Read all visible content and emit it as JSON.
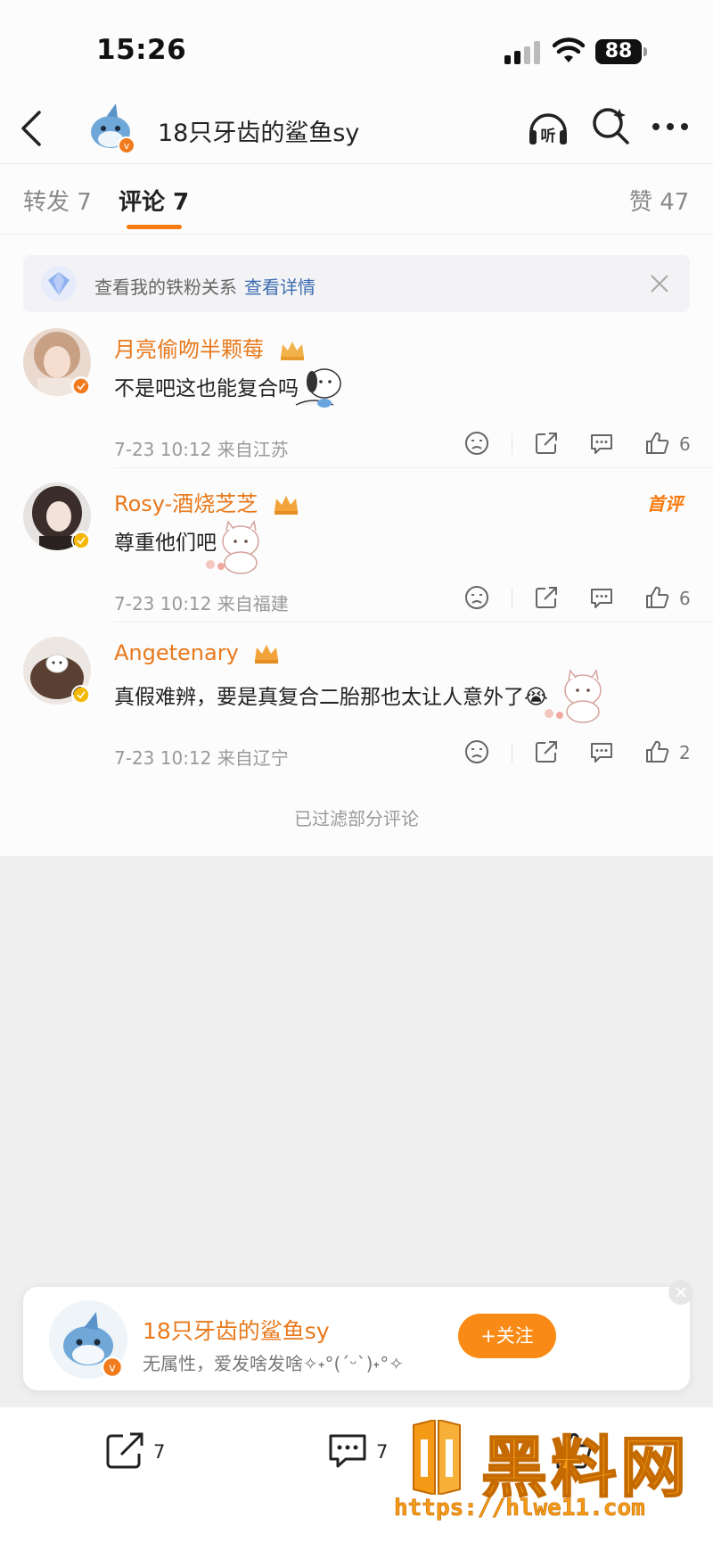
{
  "status_bar": {
    "time": "15:26",
    "battery": "88"
  },
  "nav": {
    "title": "18只牙齿的鲨鱼sy",
    "listen_label": "听"
  },
  "tabs": {
    "repost": "转发 7",
    "comment": "评论 7",
    "like": "赞 47"
  },
  "fan_banner": {
    "text": "查看我的铁粉关系",
    "link": "查看详情"
  },
  "comments": [
    {
      "name": "月亮偷吻半颗莓",
      "text": "不是吧这也能复合吗",
      "meta": "7-23 10:12  来自江苏",
      "likes": "6",
      "badge": "",
      "verify_color": "#f07a1c"
    },
    {
      "name": "Rosy-酒烧芝芝",
      "text": "尊重他们吧",
      "meta": "7-23 10:12  来自福建",
      "likes": "6",
      "badge": "首评",
      "verify_color": "#f5b800"
    },
    {
      "name": "Angetenary",
      "text": "真假难辨，要是真复合二胎那也太让人意外了😭",
      "meta": "7-23 10:12  来自辽宁",
      "likes": "2",
      "badge": "",
      "verify_color": "#f5b800"
    }
  ],
  "filtered_note": "已过滤部分评论",
  "follow_card": {
    "name": "18只牙齿的鲨鱼sy",
    "desc": "无属性，爱发啥发啥✧˖°(ˊᵕˋ)˖°✧",
    "follow_label": "+关注"
  },
  "bottom_bar": {
    "repost_count": "7",
    "comment_count": "7"
  },
  "watermark": {
    "title": "黑料网",
    "url": "https://hlwe11.com"
  },
  "colors": {
    "accent": "#f77b10",
    "name_orange": "#e8791c",
    "link_blue": "#3c6db0"
  }
}
